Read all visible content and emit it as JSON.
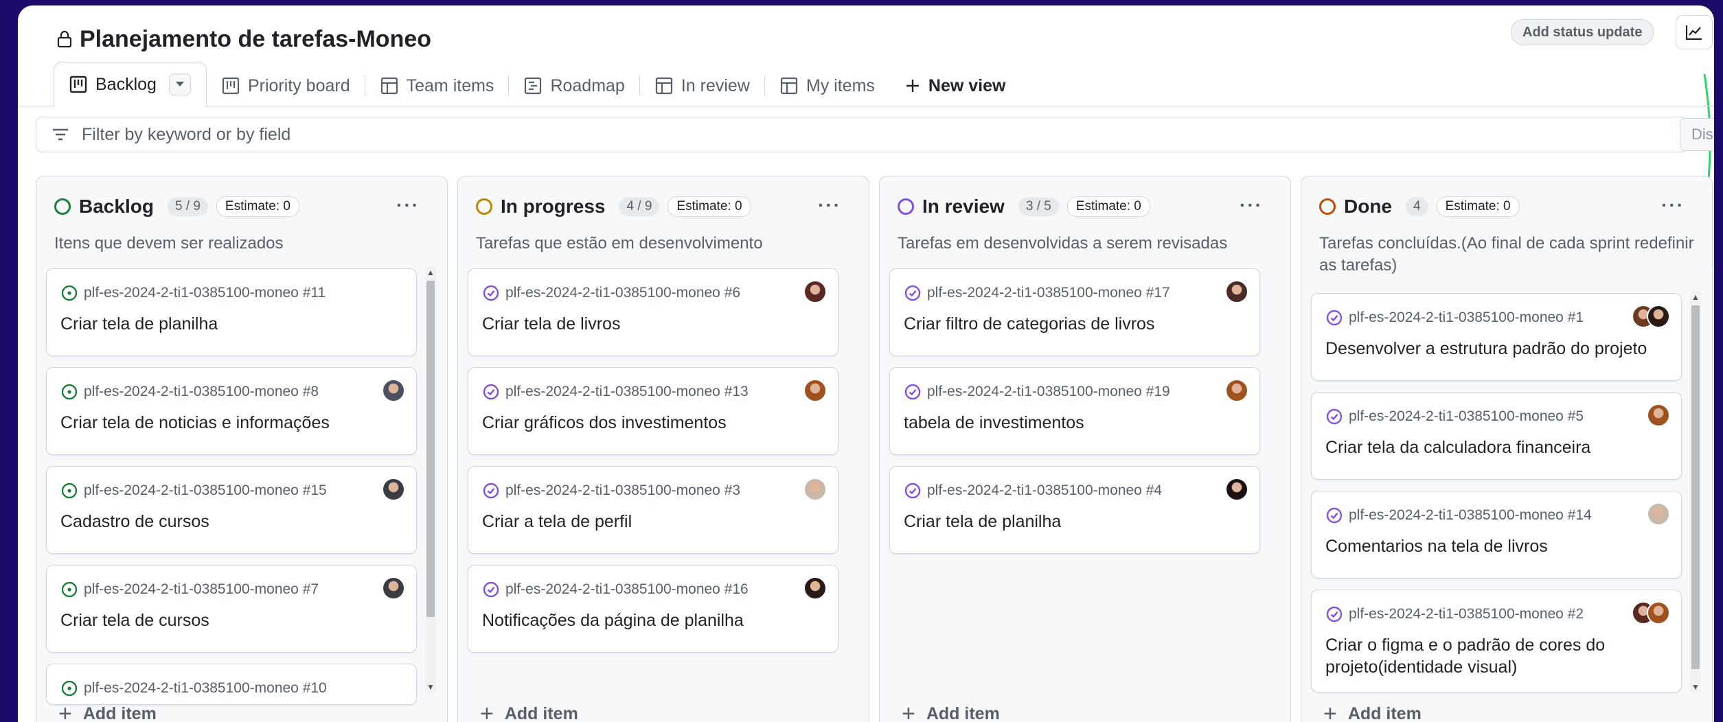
{
  "header": {
    "title": "Planejamento de tarefas-Moneo",
    "status_button": "Add status update"
  },
  "tabs": [
    {
      "label": "Backlog",
      "icon": "board-icon"
    },
    {
      "label": "Priority board",
      "icon": "board-icon"
    },
    {
      "label": "Team items",
      "icon": "table-icon"
    },
    {
      "label": "Roadmap",
      "icon": "roadmap-icon"
    },
    {
      "label": "In review",
      "icon": "table-icon"
    },
    {
      "label": "My items",
      "icon": "table-icon"
    }
  ],
  "new_view_label": "New view",
  "filter": {
    "placeholder": "Filter by keyword or by field",
    "discard_label": "Disc"
  },
  "columns": [
    {
      "name": "Backlog",
      "count": "5 / 9",
      "estimate": "Estimate: 0",
      "description": "Itens que devem ser realizados",
      "color": "#1a7f37",
      "cards": [
        {
          "id": "plf-es-2024-2-ti1-0385100-moneo #11",
          "title": "Criar tela de planilha"
        },
        {
          "id": "plf-es-2024-2-ti1-0385100-moneo #8",
          "title": "Criar tela de noticias e informações"
        },
        {
          "id": "plf-es-2024-2-ti1-0385100-moneo #15",
          "title": "Cadastro de cursos"
        },
        {
          "id": "plf-es-2024-2-ti1-0385100-moneo #7",
          "title": "Criar tela de cursos"
        },
        {
          "id": "plf-es-2024-2-ti1-0385100-moneo #10",
          "title": ""
        }
      ],
      "add_label": "Add item"
    },
    {
      "name": "In progress",
      "count": "4 / 9",
      "estimate": "Estimate: 0",
      "description": "Tarefas que estão em desenvolvimento",
      "color": "#bf8700",
      "cards": [
        {
          "id": "plf-es-2024-2-ti1-0385100-moneo #6",
          "title": "Criar tela de livros"
        },
        {
          "id": "plf-es-2024-2-ti1-0385100-moneo #13",
          "title": "Criar gráficos dos investimentos"
        },
        {
          "id": "plf-es-2024-2-ti1-0385100-moneo #3",
          "title": "Criar a tela de perfil"
        },
        {
          "id": "plf-es-2024-2-ti1-0385100-moneo #16",
          "title": "Notificações da página de planilha"
        }
      ],
      "add_label": "Add item"
    },
    {
      "name": "In review",
      "count": "3 / 5",
      "estimate": "Estimate: 0",
      "description": "Tarefas em desenvolvidas a serem revisadas",
      "color": "#8250df",
      "cards": [
        {
          "id": "plf-es-2024-2-ti1-0385100-moneo #17",
          "title": "Criar filtro de categorias de livros"
        },
        {
          "id": "plf-es-2024-2-ti1-0385100-moneo #19",
          "title": "tabela de investimentos"
        },
        {
          "id": "plf-es-2024-2-ti1-0385100-moneo #4",
          "title": "Criar tela de planilha"
        }
      ],
      "add_label": "Add item"
    },
    {
      "name": "Done",
      "count": "4",
      "estimate": "Estimate: 0",
      "description": "Tarefas concluídas.(Ao final de cada sprint redefinir as tarefas)",
      "color": "#bc4c00",
      "cards": [
        {
          "id": "plf-es-2024-2-ti1-0385100-moneo #1",
          "title": "Desenvolver a estrutura padrão do projeto"
        },
        {
          "id": "plf-es-2024-2-ti1-0385100-moneo #5",
          "title": "Criar tela da calculadora financeira"
        },
        {
          "id": "plf-es-2024-2-ti1-0385100-moneo #14",
          "title": "Comentarios na tela de livros"
        },
        {
          "id": "plf-es-2024-2-ti1-0385100-moneo #2",
          "title": "Criar o figma e o padrão de cores do projeto(identidade visual)"
        }
      ],
      "add_label": "Add item"
    }
  ]
}
